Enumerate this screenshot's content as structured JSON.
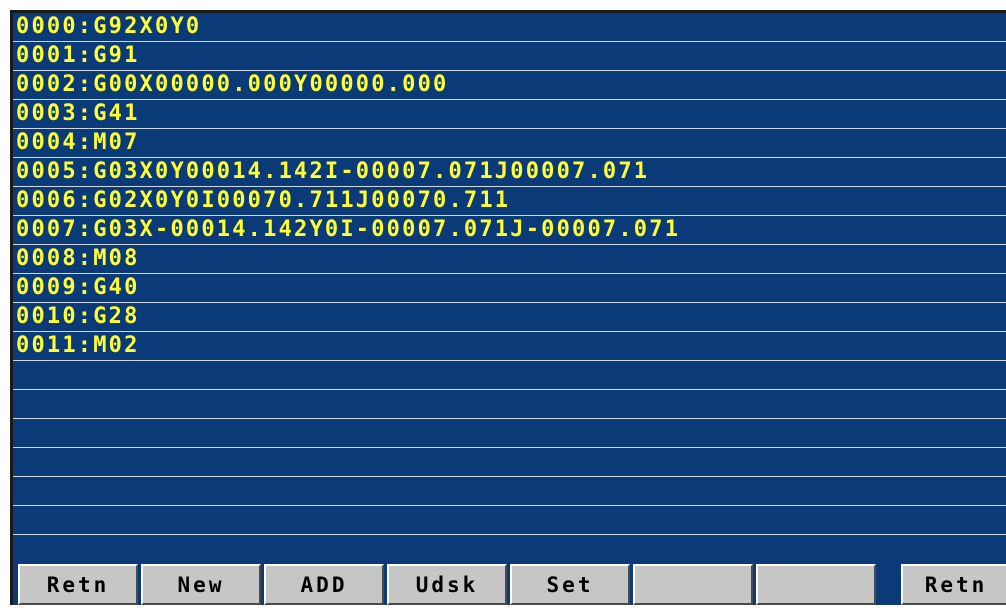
{
  "program": {
    "lines": [
      "0000:G92X0Y0",
      "0001:G91",
      "0002:G00X00000.000Y00000.000",
      "0003:G41",
      "0004:M07",
      "0005:G03X0Y00014.142I-00007.071J00007.071",
      "0006:G02X0Y0I00070.711J00070.711",
      "0007:G03X-00014.142Y0I-00007.071J-00007.071",
      "0008:M08",
      "0009:G40",
      "0010:G28",
      "0011:M02",
      "",
      "",
      "",
      "",
      "",
      ""
    ]
  },
  "softkeys": [
    "Retn",
    "New",
    "ADD",
    "Udsk",
    "Set",
    "",
    "",
    "Retn"
  ],
  "colors": {
    "background": "#0b3a78",
    "text": "#ffff33",
    "key": "#c6c6c6"
  }
}
